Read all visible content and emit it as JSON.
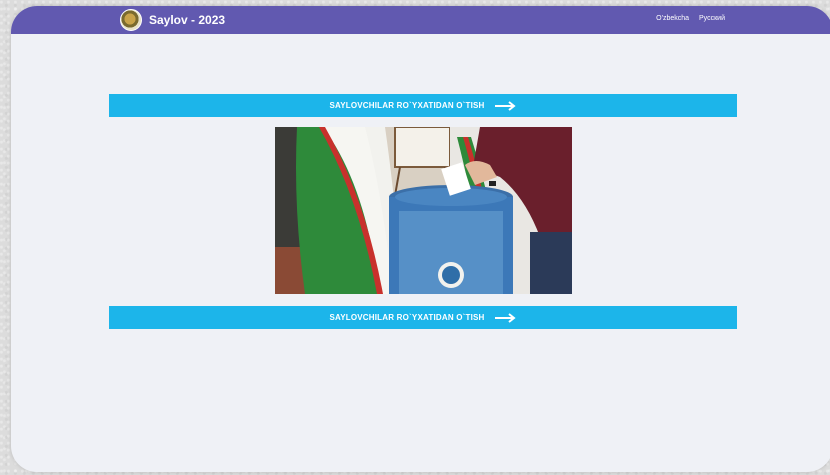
{
  "header": {
    "brand_title": "Saylov - 2023",
    "logo_icon": "emblem-logo",
    "languages": [
      "O'zbekcha",
      "Русский"
    ]
  },
  "main": {
    "cta_top_label": "SAYLOVCHILAR RO`YXATIDAN O`TISH",
    "cta_bottom_label": "SAYLOVCHILAR RO`YXATIDAN O`TISH",
    "cta_icon": "arrow-right-icon",
    "photo_icon": "voting-ballot-box-photo"
  },
  "colors": {
    "header_bg": "#6159b0",
    "page_bg": "#eff1f6",
    "cta_bg": "#1cb5ea"
  }
}
